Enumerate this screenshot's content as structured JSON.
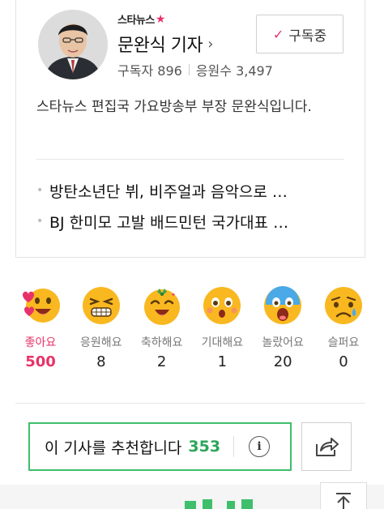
{
  "reporter": {
    "brand": "스타뉴스",
    "name": "문완식 기자",
    "subscribers_label": "구독자",
    "subscribers": "896",
    "supporters_label": "응원수",
    "supporters": "3,497",
    "subscribe_label": "구독중",
    "description": "스타뉴스 편집국 가요방송부 부장 문완식입니다."
  },
  "articles": [
    "방탄소년단 뷔, 비주얼과 음악으로 …",
    "BJ 한미모 고발 배드민턴 국가대표 …"
  ],
  "reactions": [
    {
      "label": "좋아요",
      "count": "500",
      "active": true,
      "icon": "love-emoji-icon"
    },
    {
      "label": "응원해요",
      "count": "8",
      "active": false,
      "icon": "cheer-emoji-icon"
    },
    {
      "label": "축하해요",
      "count": "2",
      "active": false,
      "icon": "congrats-emoji-icon"
    },
    {
      "label": "기대해요",
      "count": "1",
      "active": false,
      "icon": "expect-emoji-icon"
    },
    {
      "label": "놀랐어요",
      "count": "20",
      "active": false,
      "icon": "surprised-emoji-icon"
    },
    {
      "label": "슬퍼요",
      "count": "0",
      "active": false,
      "icon": "sad-emoji-icon"
    }
  ],
  "recommend": {
    "label": "이 기사를 추천합니다",
    "count": "353",
    "info_icon": "info-icon"
  },
  "colors": {
    "accent_pink": "#e8326a",
    "accent_green": "#3fbf6b",
    "emoji_yellow": "#f9b820"
  }
}
